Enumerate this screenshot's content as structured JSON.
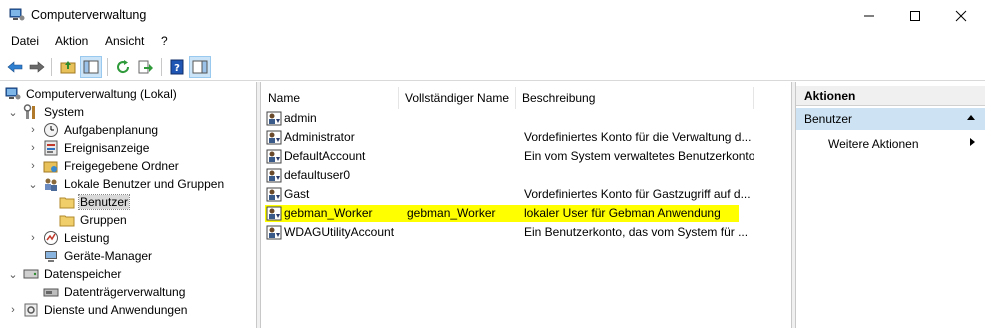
{
  "window": {
    "title": "Computerverwaltung",
    "app_icon": "computer-management-icon",
    "controls": {
      "minimize": "minimize-icon",
      "maximize": "maximize-icon",
      "close": "close-icon"
    }
  },
  "menu": {
    "items": [
      {
        "label": "Datei"
      },
      {
        "label": "Aktion"
      },
      {
        "label": "Ansicht"
      },
      {
        "label": "?"
      }
    ]
  },
  "toolbar": {
    "buttons": [
      {
        "icon": "back-arrow-icon"
      },
      {
        "icon": "forward-arrow-icon"
      },
      {
        "icon": "up-folder-icon"
      },
      {
        "icon": "show-hide-tree-icon"
      },
      {
        "icon": "refresh-icon"
      },
      {
        "icon": "export-list-icon"
      },
      {
        "icon": "help-icon"
      },
      {
        "icon": "show-hide-action-pane-icon"
      }
    ]
  },
  "tree": {
    "items": [
      {
        "label": "Computerverwaltung (Lokal)",
        "icon": "computer-management-icon",
        "expander": ""
      },
      {
        "label": "System",
        "icon": "tools-icon",
        "expander": "open"
      },
      {
        "label": "Aufgabenplanung",
        "icon": "clock-icon",
        "expander": "closed"
      },
      {
        "label": "Ereignisanzeige",
        "icon": "event-viewer-icon",
        "expander": "closed"
      },
      {
        "label": "Freigegebene Ordner",
        "icon": "shared-folder-icon",
        "expander": "closed"
      },
      {
        "label": "Lokale Benutzer und Gruppen",
        "icon": "users-groups-icon",
        "expander": "open"
      },
      {
        "label": "Benutzer",
        "icon": "folder-icon",
        "expander": ""
      },
      {
        "label": "Gruppen",
        "icon": "folder-icon",
        "expander": ""
      },
      {
        "label": "Leistung",
        "icon": "performance-icon",
        "expander": "closed"
      },
      {
        "label": "Geräte-Manager",
        "icon": "device-manager-icon",
        "expander": ""
      },
      {
        "label": "Datenspeicher",
        "icon": "storage-icon",
        "expander": "open"
      },
      {
        "label": "Datenträgerverwaltung",
        "icon": "disk-management-icon",
        "expander": ""
      },
      {
        "label": "Dienste und Anwendungen",
        "icon": "services-icon",
        "expander": "closed"
      }
    ]
  },
  "list": {
    "columns": [
      "Name",
      "Vollständiger Name",
      "Beschreibung"
    ],
    "rows": [
      {
        "name": "admin",
        "full_name": "",
        "description": ""
      },
      {
        "name": "Administrator",
        "full_name": "",
        "description": "Vordefiniertes Konto für die Verwaltung d..."
      },
      {
        "name": "DefaultAccount",
        "full_name": "",
        "description": "Ein vom System verwaltetes Benutzerkonto..."
      },
      {
        "name": "defaultuser0",
        "full_name": "",
        "description": ""
      },
      {
        "name": "Gast",
        "full_name": "",
        "description": "Vordefiniertes Konto für Gastzugriff auf d..."
      },
      {
        "name": "gebman_Worker",
        "full_name": "gebman_Worker",
        "description": "lokaler User für Gebman Anwendung"
      },
      {
        "name": "WDAGUtilityAccount",
        "full_name": "",
        "description": "Ein Benutzerkonto, das vom System für ..."
      }
    ],
    "highlight_color": "#ffff00"
  },
  "actions": {
    "header": "Aktionen",
    "section": "Benutzer",
    "items": [
      {
        "label": "Weitere Aktionen"
      }
    ]
  },
  "colors": {
    "selection_blue": "#cde3f4",
    "highlight": "#ffff00"
  }
}
